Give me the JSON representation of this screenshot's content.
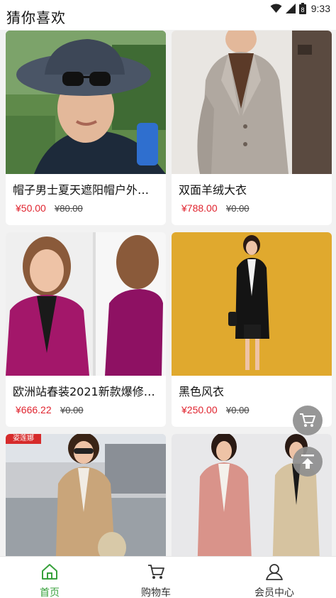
{
  "status_bar": {
    "time": "9:33",
    "battery_level": "8"
  },
  "header": {
    "title": "猜你喜欢"
  },
  "products": [
    {
      "name": "帽子男士夏天遮阳帽户外…",
      "price": "¥50.00",
      "original_price": "¥80.00",
      "image": "man-in-bucket-hat-photo"
    },
    {
      "name": "双面羊绒大衣",
      "price": "¥788.00",
      "original_price": "¥0.00",
      "image": "grey-wool-coat-photo"
    },
    {
      "name": "欧洲站春装2021新款爆修…",
      "price": "¥666.22",
      "original_price": "¥0.00",
      "image": "magenta-blazer-photo"
    },
    {
      "name": "黑色风衣",
      "price": "¥250.00",
      "original_price": "¥0.00",
      "image": "black-trench-coat-photo"
    },
    {
      "name": "",
      "price": "",
      "original_price": "",
      "image": "camel-trench-coat-photo",
      "badge": "姿莲娜"
    },
    {
      "name": "",
      "price": "",
      "original_price": "",
      "image": "pink-and-beige-coat-photo"
    }
  ],
  "floating_buttons": [
    "cart-icon",
    "back-to-top-icon"
  ],
  "tabbar": {
    "items": [
      {
        "label": "首页",
        "icon": "home-icon",
        "active": true
      },
      {
        "label": "购物车",
        "icon": "cart-icon",
        "active": false
      },
      {
        "label": "会员中心",
        "icon": "user-icon",
        "active": false
      }
    ],
    "active_color": "#38a13c"
  },
  "colors": {
    "price": "#e0242f",
    "background": "#f2f2f2"
  }
}
